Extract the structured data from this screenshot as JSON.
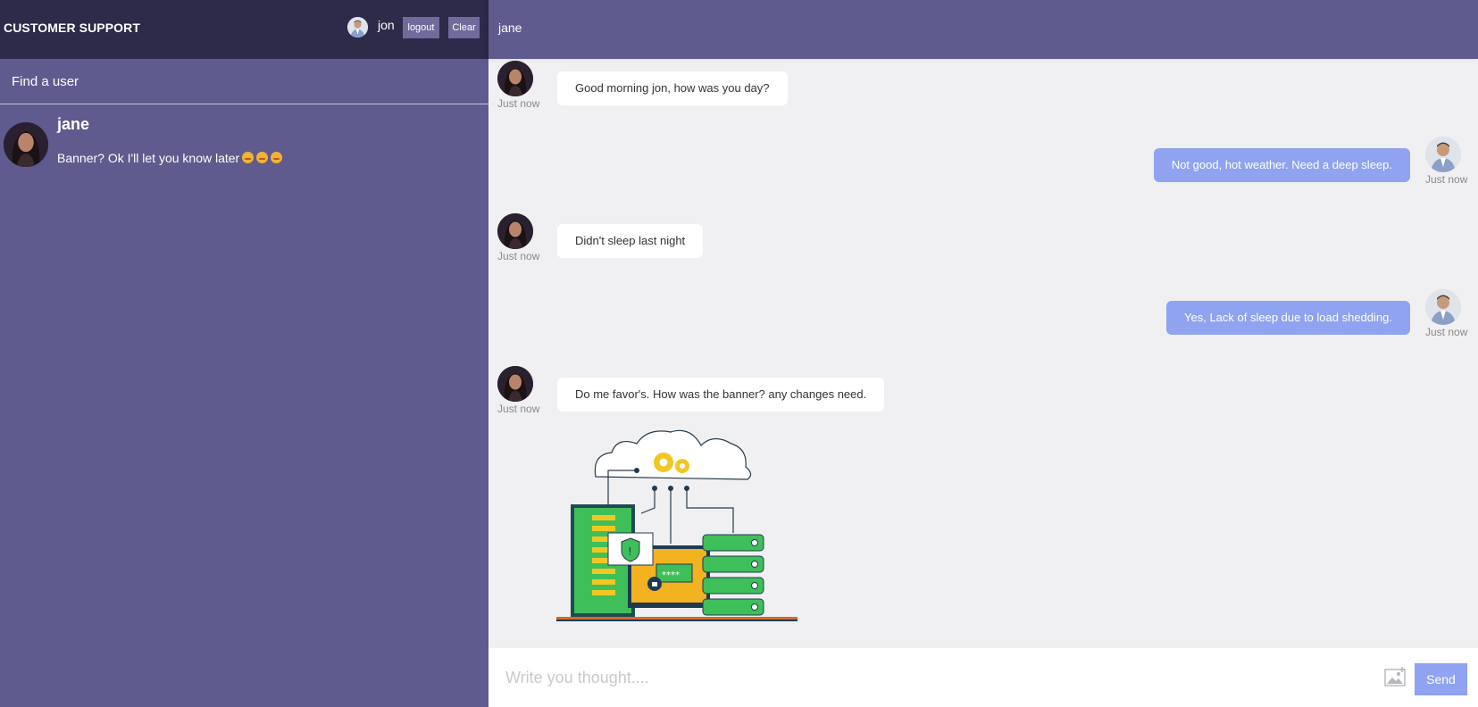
{
  "app": {
    "brand": "CUSTOMER SUPPORT",
    "current_user": "jon",
    "logout_label": "logout",
    "clear_label": "Clear"
  },
  "search": {
    "placeholder": "Find a user"
  },
  "contacts": [
    {
      "name": "jane",
      "preview": "Banner? Ok I'll let you know later"
    }
  ],
  "chat": {
    "title": "jane",
    "messages": [
      {
        "direction": "in",
        "text": "Good morning jon, how was you day?",
        "time": "Just now"
      },
      {
        "direction": "out",
        "text": "Not good, hot weather. Need a deep sleep.",
        "time": "Just now"
      },
      {
        "direction": "in",
        "text": "Didn't sleep last night",
        "time": "Just now"
      },
      {
        "direction": "out",
        "text": "Yes, Lack of sleep due to load shedding.",
        "time": "Just now"
      },
      {
        "direction": "in",
        "text": "Do me favor's. How was the banner? any changes need.",
        "time": "Just now"
      }
    ]
  },
  "composer": {
    "placeholder": "Write you thought....",
    "send_label": "Send",
    "attach_icon": "image-icon"
  },
  "colors": {
    "sidebar_header": "#2d2a4a",
    "sidebar_bg": "#5f5b8e",
    "outgoing_bubble": "#8fa3f0",
    "send_button": "#8fa3f0",
    "chat_bg": "#f0f0f2"
  }
}
